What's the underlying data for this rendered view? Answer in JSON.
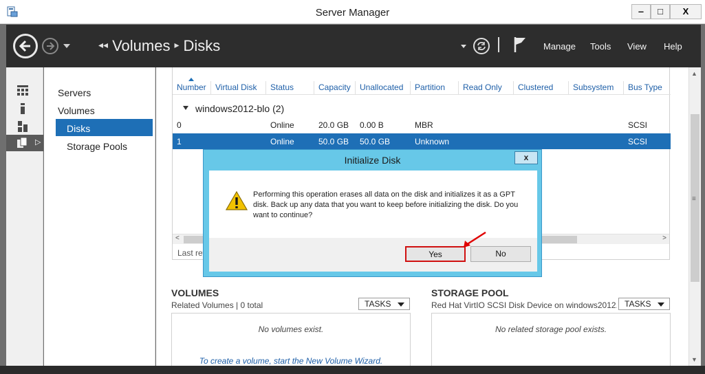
{
  "window": {
    "title": "Server Manager",
    "minimize": "‒",
    "maximize": "□",
    "close": "X"
  },
  "header": {
    "breadcrumb_root": "Volumes",
    "breadcrumb_current": "Disks",
    "menus": [
      "Manage",
      "Tools",
      "View",
      "Help"
    ]
  },
  "nav": {
    "items": [
      "Servers",
      "Volumes",
      "Disks",
      "Storage Pools"
    ],
    "selected": "Disks"
  },
  "disks": {
    "columns": [
      "Number",
      "Virtual Disk",
      "Status",
      "Capacity",
      "Unallocated",
      "Partition",
      "Read Only",
      "Clustered",
      "Subsystem",
      "Bus Type"
    ],
    "group_label": "windows2012-blo (2)",
    "rows": [
      {
        "number": "0",
        "status": "Online",
        "capacity": "20.0 GB",
        "unallocated": "0.00 B",
        "partition": "MBR",
        "bus_type": "SCSI"
      },
      {
        "number": "1",
        "status": "Online",
        "capacity": "50.0 GB",
        "unallocated": "50.0 GB",
        "partition": "Unknown",
        "bus_type": "SCSI"
      }
    ],
    "selected_row": 1,
    "last_refreshed": "Last ref"
  },
  "volumes": {
    "title": "VOLUMES",
    "subtitle": "Related Volumes | 0 total",
    "tasks": "TASKS",
    "empty": "No volumes exist.",
    "link": "To create a volume, start the New Volume Wizard."
  },
  "storage_pool": {
    "title": "STORAGE POOL",
    "subtitle": "Red Hat VirtIO SCSI Disk Device on windows2012...",
    "tasks": "TASKS",
    "empty": "No related storage pool exists."
  },
  "dialog": {
    "title": "Initialize Disk",
    "close": "x",
    "message": "Performing this operation erases all data on the disk and initializes it as a GPT disk. Back up any data that you want to keep before initializing the disk. Do you want to continue?",
    "yes": "Yes",
    "no": "No"
  },
  "colors": {
    "accent": "#1e6fb6",
    "dialog_frame": "#67c8e8",
    "highlight": "#d01010"
  }
}
